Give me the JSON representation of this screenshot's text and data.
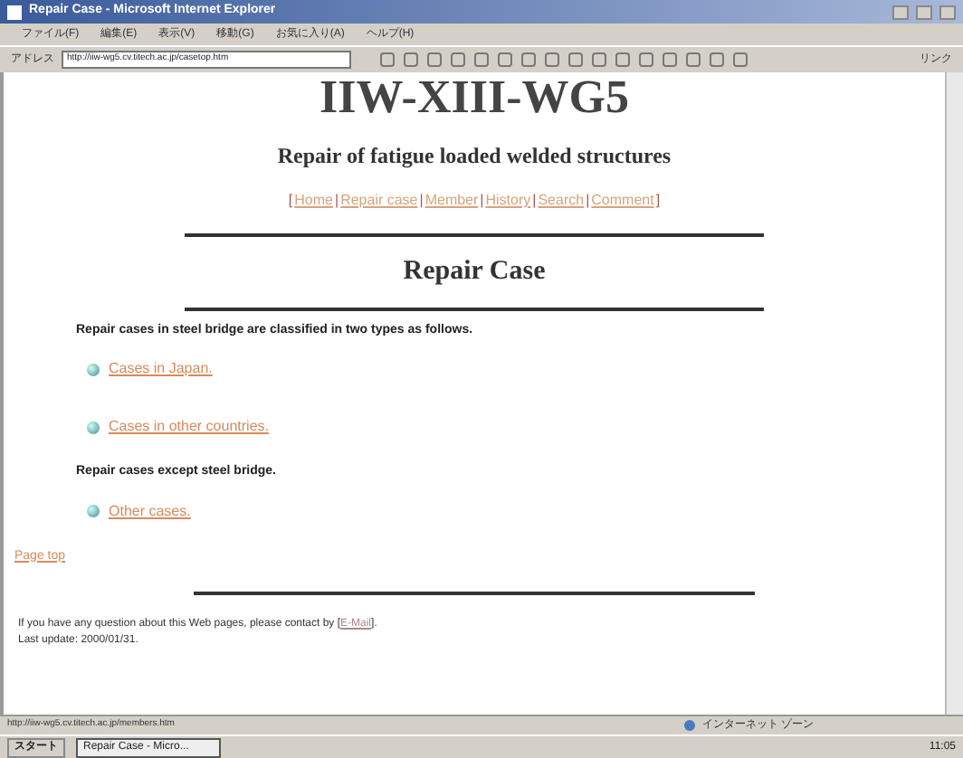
{
  "window": {
    "title": "Repair Case - Microsoft Internet Explorer"
  },
  "menu": [
    "ファイル(F)",
    "編集(E)",
    "表示(V)",
    "移動(G)",
    "お気に入り(A)",
    "ヘルプ(H)"
  ],
  "address": {
    "label": "アドレス",
    "value": "http://iiw-wg5.cv.titech.ac.jp/casetop.htm",
    "side_label": "リンク"
  },
  "page": {
    "heading": "IIW-XIII-WG5",
    "subtitle": "Repair of fatigue loaded welded structures",
    "nav": [
      {
        "kind": "text",
        "text": "["
      },
      {
        "kind": "link",
        "text": "Home"
      },
      {
        "kind": "text",
        "text": "|"
      },
      {
        "kind": "link",
        "text": "Repair case"
      },
      {
        "kind": "text",
        "text": "|"
      },
      {
        "kind": "link",
        "text": "Member"
      },
      {
        "kind": "text",
        "text": "|"
      },
      {
        "kind": "link",
        "text": "History"
      },
      {
        "kind": "text",
        "text": "|"
      },
      {
        "kind": "link",
        "text": "Search"
      },
      {
        "kind": "text",
        "text": "|"
      },
      {
        "kind": "link",
        "text": "Comment"
      },
      {
        "kind": "text",
        "text": "]"
      }
    ],
    "section_title": "Repair Case",
    "groups": [
      {
        "intro": "Repair cases in steel bridge are classified in two types as follows.",
        "links": [
          "Cases in Japan.",
          "Cases in other countries."
        ]
      },
      {
        "intro": "Repair cases except steel bridge.",
        "links": [
          "Other cases."
        ]
      }
    ],
    "page_top": "Page top",
    "contact": "If you have any question about this Web pages, please contact by [",
    "contact_link": "E-Mail",
    "contact_end": "].",
    "updated": "Last update: 2000/01/31."
  },
  "status_bar": {
    "url": "http://iiw-wg5.cv.titech.ac.jp/members.htm",
    "zone": "インターネット ゾーン"
  },
  "taskbar": {
    "start": "スタート",
    "task": "Repair Case - Micro...",
    "clock": "11:05"
  }
}
